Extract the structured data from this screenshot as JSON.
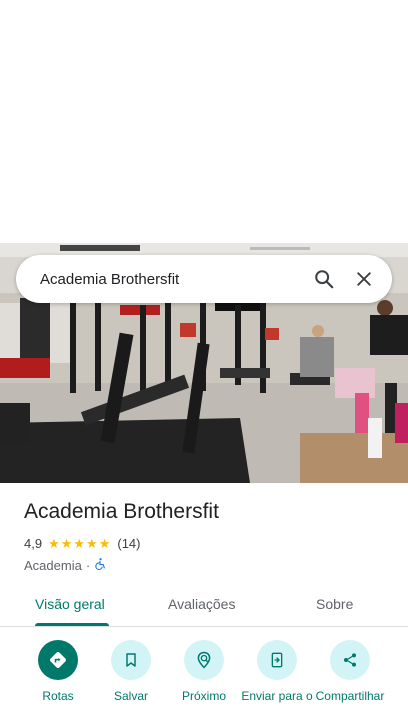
{
  "search": {
    "query": "Academia Brothersfit",
    "search_icon": "search-icon",
    "close_icon": "close-icon"
  },
  "photo": {
    "description_icon": "place-photo"
  },
  "place": {
    "name": "Academia Brothersfit",
    "rating": "4,9",
    "stars": 5,
    "review_count": "(14)",
    "category": "Academia",
    "separator": "·",
    "accessibility_icon": "wheelchair-icon"
  },
  "tabs": [
    {
      "label": "Visão geral",
      "active": true
    },
    {
      "label": "Avaliações",
      "active": false
    },
    {
      "label": "Sobre",
      "active": false
    }
  ],
  "actions": [
    {
      "label": "Rotas",
      "icon": "directions-icon"
    },
    {
      "label": "Salvar",
      "icon": "bookmark-icon"
    },
    {
      "label": "Próximo",
      "icon": "nearby-icon"
    },
    {
      "label": "Enviar para o",
      "icon": "send-to-phone-icon"
    },
    {
      "label": "Compartilhar",
      "icon": "share-icon"
    }
  ],
  "colors": {
    "accent": "#00796b",
    "accent_light": "#d3f4f7",
    "star": "#fbbc04"
  }
}
